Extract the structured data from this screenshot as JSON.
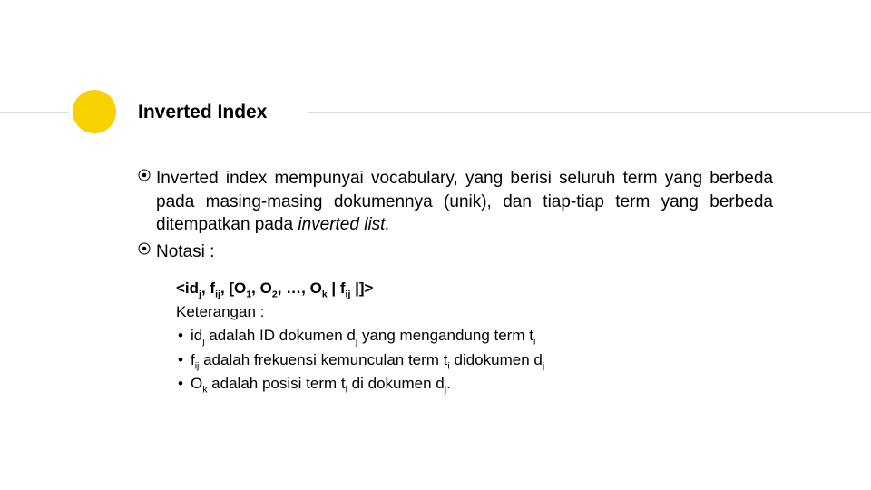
{
  "colors": {
    "accent": "#f7d100"
  },
  "title": "Inverted Index",
  "bullets": [
    {
      "text_html": "Inverted index mempunyai vocabulary, yang berisi seluruh term yang berbeda pada masing-masing dokumennya (unik), dan tiap-tiap term yang berbeda ditempatkan pada <span class='italic'>inverted list.</span>"
    },
    {
      "text_html": "Notasi :"
    }
  ],
  "notation_html": "&lt;id<sub>j</sub>, f<sub>ij</sub>, [O<sub>1</sub>, O<sub>2</sub>, …, O<sub>k</sub> | f<sub>ij</sub> |]&gt;",
  "keterangan_label": "Keterangan :",
  "keterangan_items": [
    "id<sub>j</sub> adalah ID dokumen d<sub>j</sub> yang mengandung term t<sub>i</sub>",
    "f<sub>ij</sub> adalah frekuensi kemunculan term t<sub>i</sub> didokumen d<sub>j</sub>",
    "O<sub>k</sub> adalah posisi term t<sub>i</sub> di dokumen d<sub>j</sub>."
  ]
}
